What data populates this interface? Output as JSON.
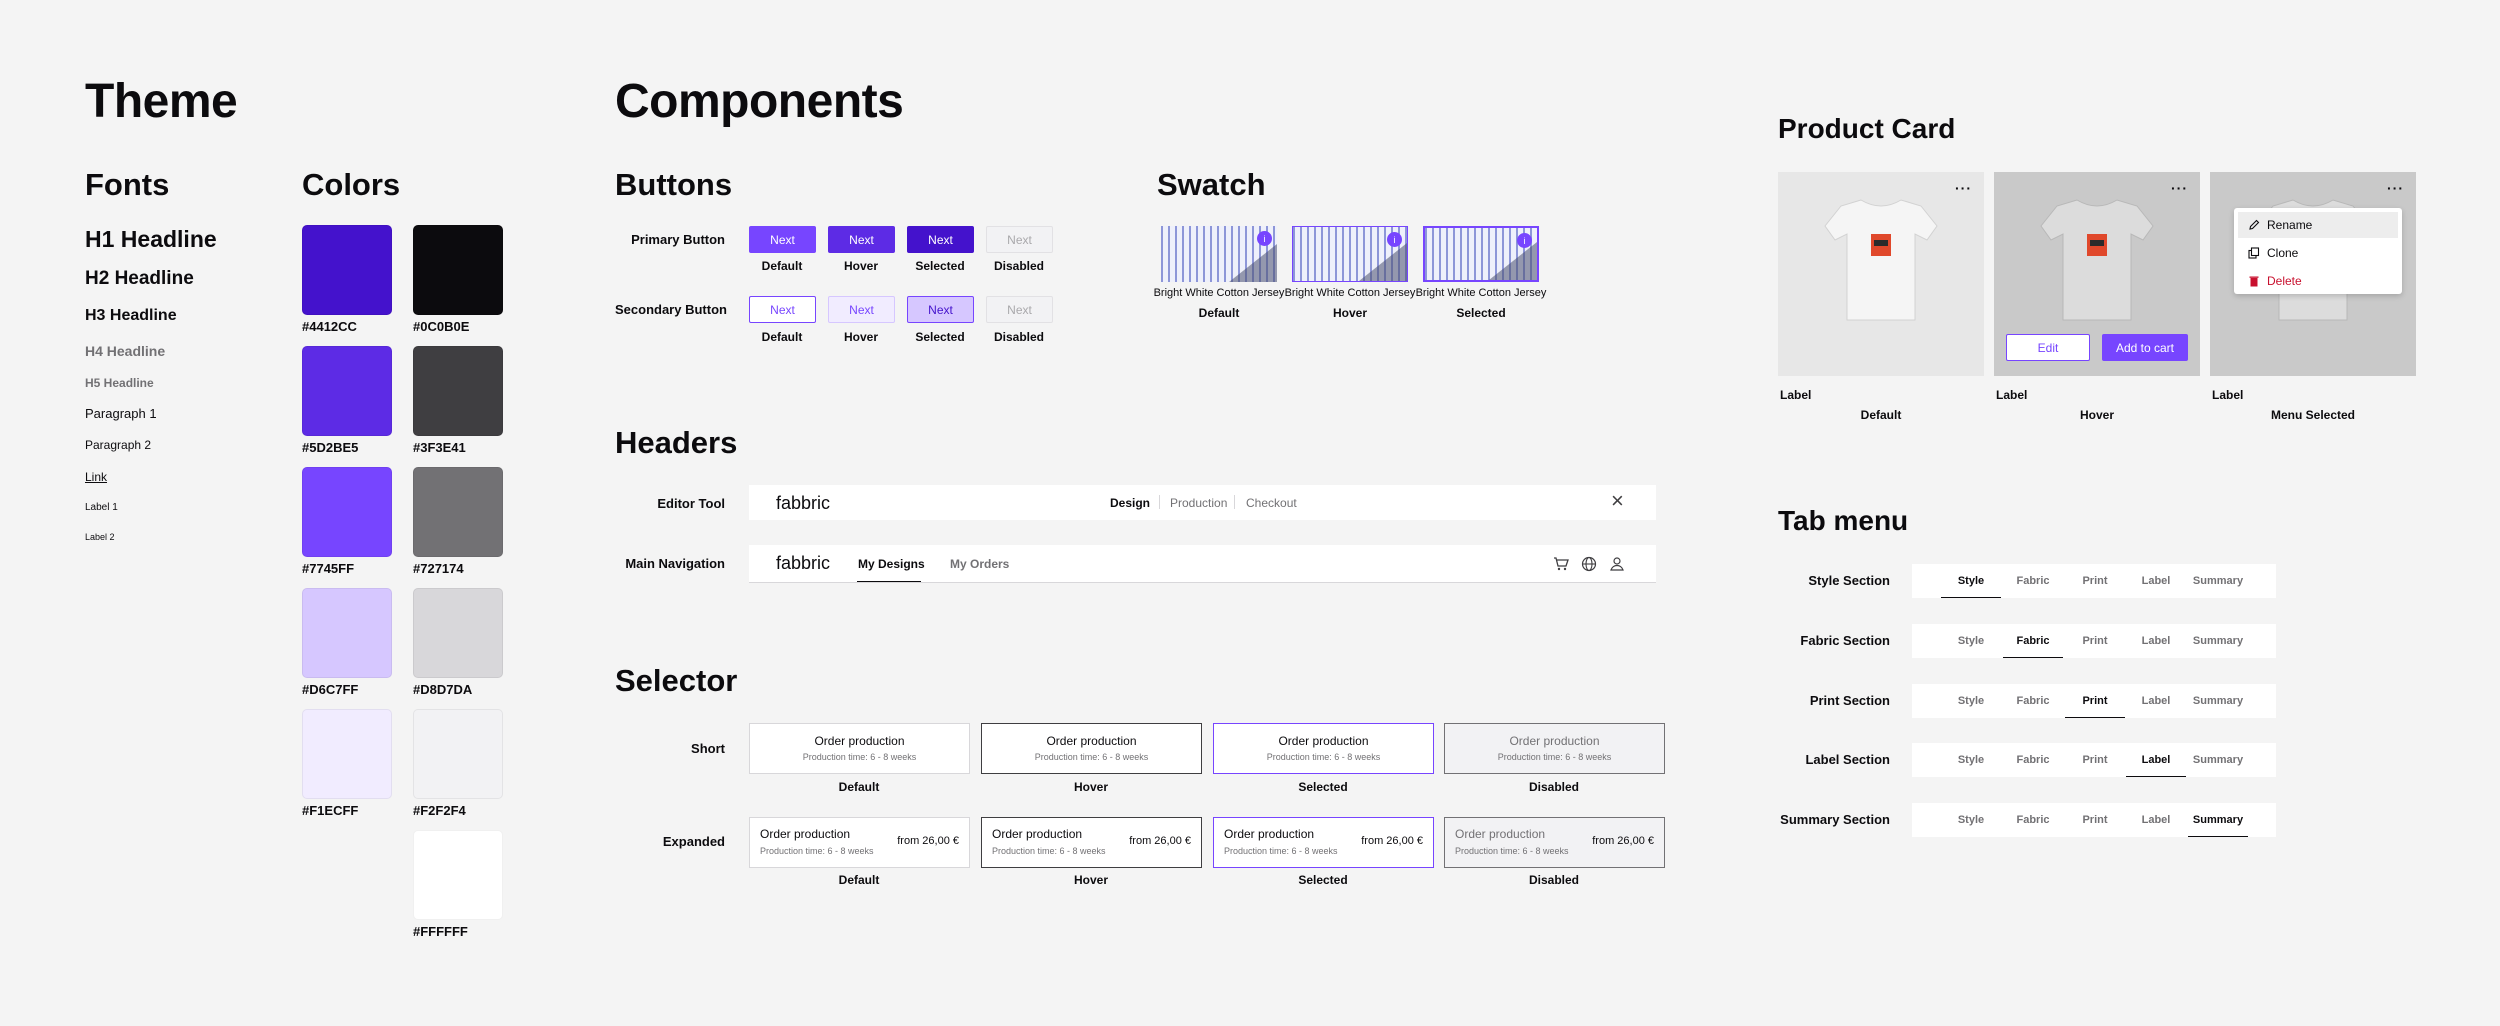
{
  "theme": {
    "title": "Theme",
    "fonts_title": "Fonts",
    "colors_title": "Colors",
    "fonts": [
      "H1 Headline",
      "H2 Headline",
      "H3 Headline",
      "H4 Headline",
      "H5 Headline",
      "Paragraph 1",
      "Paragraph 2",
      "Link",
      "Label 1",
      "Label 2"
    ],
    "colors_left": [
      "#4412CC",
      "#5D2BE5",
      "#7745FF",
      "#D6C7FF",
      "#F1ECFF"
    ],
    "colors_right": [
      "#0C0B0E",
      "#3F3E41",
      "#727174",
      "#D8D7DA",
      "#F2F2F4",
      "#FFFFFF"
    ]
  },
  "components": {
    "title": "Components",
    "buttons": {
      "title": "Buttons",
      "primary_label": "Primary Button",
      "secondary_label": "Secondary Button",
      "button_text": "Next",
      "states": [
        "Default",
        "Hover",
        "Selected",
        "Disabled"
      ]
    },
    "swatch": {
      "title": "Swatch",
      "fabric_name": "Bright White Cotton Jersey",
      "badge": "i",
      "states": [
        "Default",
        "Hover",
        "Selected"
      ]
    },
    "headers": {
      "title": "Headers",
      "editor_label": "Editor Tool",
      "main_nav_label": "Main Navigation",
      "logo": "fabbric",
      "steps": [
        "Design",
        "Production",
        "Checkout"
      ],
      "close_icon": "×",
      "nav_links": [
        "My Designs",
        "My Orders"
      ]
    },
    "selector": {
      "title": "Selector",
      "short_label": "Short",
      "expanded_label": "Expanded",
      "option_title": "Order production",
      "option_subtitle": "Production time: 6 - 8 weeks",
      "price": "from 26,00 €",
      "states": [
        "Default",
        "Hover",
        "Selected",
        "Disabled"
      ]
    }
  },
  "product_card": {
    "title": "Product Card",
    "card_label": "Label",
    "states": [
      "Default",
      "Hover",
      "Menu Selected"
    ],
    "menu_dots": "···",
    "edit_label": "Edit",
    "add_to_cart_label": "Add to cart",
    "menu": [
      "Rename",
      "Clone",
      "Delete"
    ]
  },
  "tab_menu": {
    "title": "Tab menu",
    "sections": [
      "Style Section",
      "Fabric Section",
      "Print Section",
      "Label Section",
      "Summary Section"
    ],
    "tabs": [
      "Style",
      "Fabric",
      "Print",
      "Label",
      "Summary"
    ]
  },
  "colors": {
    "accent": "#7745FF",
    "accent_dark": "#4412CC",
    "accent_mid": "#5D2BE5",
    "accent_light": "#D6C7FF",
    "accent_lighter": "#F1ECFF",
    "danger": "#C8102E"
  }
}
